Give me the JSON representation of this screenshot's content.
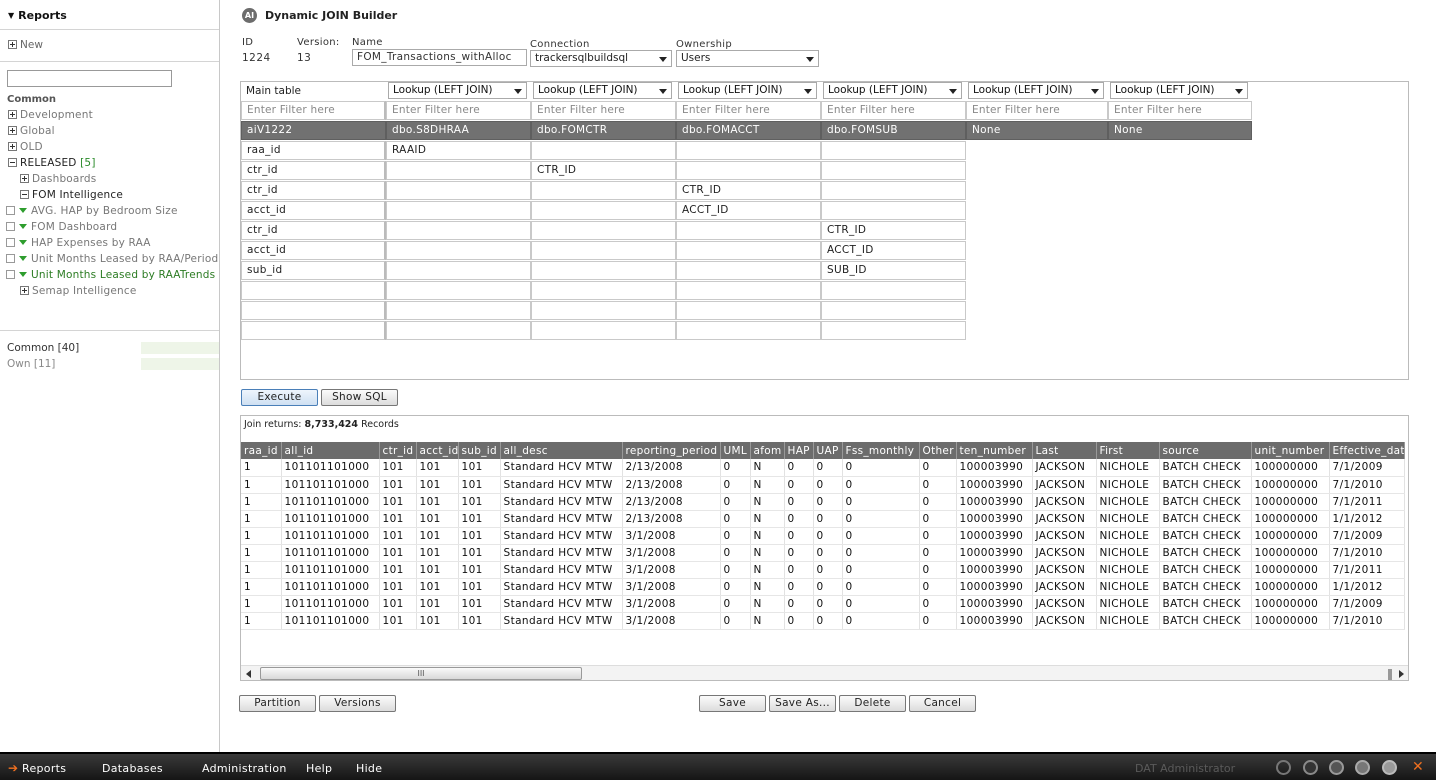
{
  "sidebar": {
    "header": "Reports",
    "new_label": "New",
    "search_value": "",
    "tree": {
      "common_label": "Common",
      "development": "Development",
      "global": "Global",
      "old": "OLD",
      "released": "RELEASED",
      "released_count": "[5]",
      "dashboards": "Dashboards",
      "fom_intelligence": "FOM Intelligence",
      "reports": [
        "AVG. HAP by Bedroom Size",
        "FOM Dashboard",
        "HAP Expenses by RAA",
        "Unit Months Leased by RAA/Period",
        "Unit Months Leased by RAATrends"
      ],
      "semap_intelligence": "Semap Intelligence"
    },
    "footer": {
      "common": "Common [40]",
      "own": "Own [11]"
    }
  },
  "main": {
    "title": "Dynamic JOIN Builder",
    "title_icon": "AI",
    "id_label": "ID",
    "id_value": "1224",
    "version_label": "Version:",
    "version_value": "13",
    "name_label": "Name",
    "name_value": "FOM_Transactions_withAlloc",
    "connection_label": "Connection",
    "connection_value": "trackersqlbuildsql",
    "ownership_label": "Ownership",
    "ownership_value": "Users"
  },
  "join": {
    "main_table_label": "Main table",
    "join_type": "Lookup (LEFT JOIN)",
    "filter_placeholder": "Enter Filter here",
    "tables": [
      "aiV1222",
      "dbo.S8DHRAA",
      "dbo.FOMCTR",
      "dbo.FOMACCT",
      "dbo.FOMSUB",
      "None",
      "None"
    ],
    "keys": [
      {
        "field": "raa_id",
        "cols": [
          "RAAID",
          "",
          "",
          ""
        ]
      },
      {
        "field": "ctr_id",
        "cols": [
          "",
          "CTR_ID",
          "",
          ""
        ]
      },
      {
        "field": "ctr_id",
        "cols": [
          "",
          "",
          "CTR_ID",
          ""
        ]
      },
      {
        "field": "acct_id",
        "cols": [
          "",
          "",
          "ACCT_ID",
          ""
        ]
      },
      {
        "field": "ctr_id",
        "cols": [
          "",
          "",
          "",
          "CTR_ID"
        ]
      },
      {
        "field": "acct_id",
        "cols": [
          "",
          "",
          "",
          "ACCT_ID"
        ]
      },
      {
        "field": "sub_id",
        "cols": [
          "",
          "",
          "",
          "SUB_ID"
        ]
      },
      {
        "field": "",
        "cols": [
          "",
          "",
          "",
          ""
        ]
      },
      {
        "field": "",
        "cols": [
          "",
          "",
          "",
          ""
        ]
      },
      {
        "field": "",
        "cols": [
          "",
          "",
          "",
          ""
        ]
      }
    ]
  },
  "buttons": {
    "execute": "Execute",
    "show_sql": "Show SQL",
    "partition": "Partition",
    "versions": "Versions",
    "save": "Save",
    "save_as": "Save As...",
    "delete": "Delete",
    "cancel": "Cancel"
  },
  "results": {
    "join_returns_label": "Join returns:",
    "count": "8,733,424",
    "records_label": "Records",
    "scroll_grip": "III",
    "columns": [
      "raa_id",
      "all_id",
      "ctr_id",
      "acct_id",
      "sub_id",
      "all_desc",
      "reporting_period",
      "UML",
      "afom",
      "HAP",
      "UAP",
      "Fss_monthly",
      "Other",
      "ten_number",
      "Last",
      "First",
      "source",
      "unit_number",
      "Effective_date"
    ],
    "rows": [
      [
        "1",
        "101101101000",
        "101",
        "101",
        "101",
        "Standard HCV MTW",
        "2/13/2008",
        "0",
        "N",
        "0",
        "0",
        "0",
        "0",
        "100003990",
        "JACKSON",
        "NICHOLE",
        "BATCH CHECK",
        "100000000",
        "7/1/2009"
      ],
      [
        "1",
        "101101101000",
        "101",
        "101",
        "101",
        "Standard HCV MTW",
        "2/13/2008",
        "0",
        "N",
        "0",
        "0",
        "0",
        "0",
        "100003990",
        "JACKSON",
        "NICHOLE",
        "BATCH CHECK",
        "100000000",
        "7/1/2010"
      ],
      [
        "1",
        "101101101000",
        "101",
        "101",
        "101",
        "Standard HCV MTW",
        "2/13/2008",
        "0",
        "N",
        "0",
        "0",
        "0",
        "0",
        "100003990",
        "JACKSON",
        "NICHOLE",
        "BATCH CHECK",
        "100000000",
        "7/1/2011"
      ],
      [
        "1",
        "101101101000",
        "101",
        "101",
        "101",
        "Standard HCV MTW",
        "2/13/2008",
        "0",
        "N",
        "0",
        "0",
        "0",
        "0",
        "100003990",
        "JACKSON",
        "NICHOLE",
        "BATCH CHECK",
        "100000000",
        "1/1/2012"
      ],
      [
        "1",
        "101101101000",
        "101",
        "101",
        "101",
        "Standard HCV MTW",
        "3/1/2008",
        "0",
        "N",
        "0",
        "0",
        "0",
        "0",
        "100003990",
        "JACKSON",
        "NICHOLE",
        "BATCH CHECK",
        "100000000",
        "7/1/2009"
      ],
      [
        "1",
        "101101101000",
        "101",
        "101",
        "101",
        "Standard HCV MTW",
        "3/1/2008",
        "0",
        "N",
        "0",
        "0",
        "0",
        "0",
        "100003990",
        "JACKSON",
        "NICHOLE",
        "BATCH CHECK",
        "100000000",
        "7/1/2010"
      ],
      [
        "1",
        "101101101000",
        "101",
        "101",
        "101",
        "Standard HCV MTW",
        "3/1/2008",
        "0",
        "N",
        "0",
        "0",
        "0",
        "0",
        "100003990",
        "JACKSON",
        "NICHOLE",
        "BATCH CHECK",
        "100000000",
        "7/1/2011"
      ],
      [
        "1",
        "101101101000",
        "101",
        "101",
        "101",
        "Standard HCV MTW",
        "3/1/2008",
        "0",
        "N",
        "0",
        "0",
        "0",
        "0",
        "100003990",
        "JACKSON",
        "NICHOLE",
        "BATCH CHECK",
        "100000000",
        "1/1/2012"
      ],
      [
        "1",
        "101101101000",
        "101",
        "101",
        "101",
        "Standard HCV MTW",
        "3/1/2008",
        "0",
        "N",
        "0",
        "0",
        "0",
        "0",
        "100003990",
        "JACKSON",
        "NICHOLE",
        "BATCH CHECK",
        "100000000",
        "7/1/2009"
      ],
      [
        "1",
        "101101101000",
        "101",
        "101",
        "101",
        "Standard HCV MTW",
        "3/1/2008",
        "0",
        "N",
        "0",
        "0",
        "0",
        "0",
        "100003990",
        "JACKSON",
        "NICHOLE",
        "BATCH CHECK",
        "100000000",
        "7/1/2010"
      ]
    ]
  },
  "taskbar": {
    "items": [
      "Reports",
      "Databases",
      "Administration",
      "Help",
      "Hide"
    ],
    "user": "DAT Administrator"
  },
  "colors": {
    "accent_orange": "#f07020",
    "header_gray": "#6c6c6c",
    "tree_green": "#2c7c23"
  }
}
